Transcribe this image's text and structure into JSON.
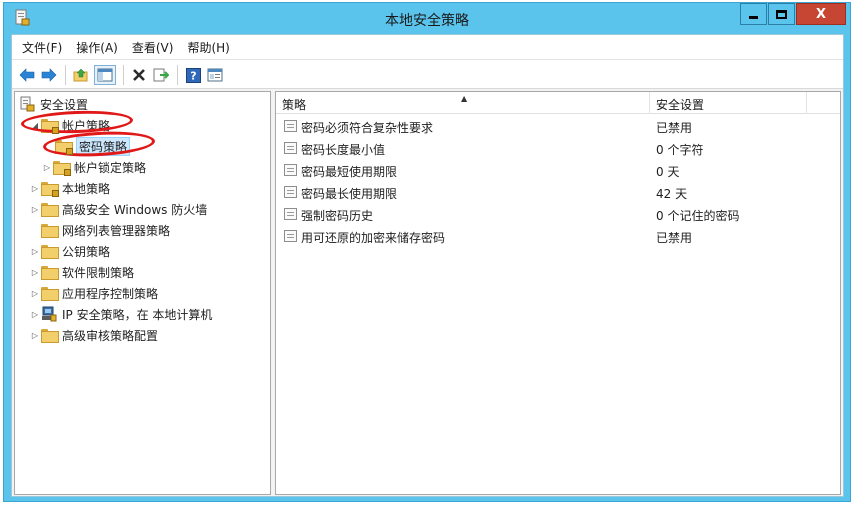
{
  "window": {
    "title": "本地安全策略",
    "close_glyph": "X"
  },
  "menu": [
    "文件(F)",
    "操作(A)",
    "查看(V)",
    "帮助(H)"
  ],
  "toolbar": {
    "buttons": [
      "back-arrow-icon",
      "forward-arrow-icon",
      "up-folder-icon",
      "show-hide-tree-icon",
      "delete-icon",
      "export-list-icon",
      "help-icon",
      "properties-icon"
    ],
    "help_glyph": "?"
  },
  "tree": {
    "root": "安全设置",
    "items": [
      {
        "label": "帐户策略",
        "expanded": true
      },
      {
        "label": "密码策略",
        "selected": true
      },
      {
        "label": "帐户锁定策略"
      },
      {
        "label": "本地策略"
      },
      {
        "label": "高级安全 Windows 防火墙"
      },
      {
        "label": "网络列表管理器策略"
      },
      {
        "label": "公钥策略"
      },
      {
        "label": "软件限制策略"
      },
      {
        "label": "应用程序控制策略"
      },
      {
        "label": "IP 安全策略，在 本地计算机"
      },
      {
        "label": "高级审核策略配置"
      }
    ]
  },
  "list": {
    "columns": [
      "策略",
      "安全设置"
    ],
    "rows": [
      {
        "policy": "密码必须符合复杂性要求",
        "setting": "已禁用"
      },
      {
        "policy": "密码长度最小值",
        "setting": "0 个字符"
      },
      {
        "policy": "密码最短使用期限",
        "setting": "0 天"
      },
      {
        "policy": "密码最长使用期限",
        "setting": "42 天"
      },
      {
        "policy": "强制密码历史",
        "setting": "0 个记住的密码"
      },
      {
        "policy": "用可还原的加密来储存密码",
        "setting": "已禁用"
      }
    ]
  },
  "colors": {
    "titlebar": "#5bc4ec",
    "close_button": "#c74633",
    "annotation": "#e01818",
    "selection": "#cce8ff"
  }
}
